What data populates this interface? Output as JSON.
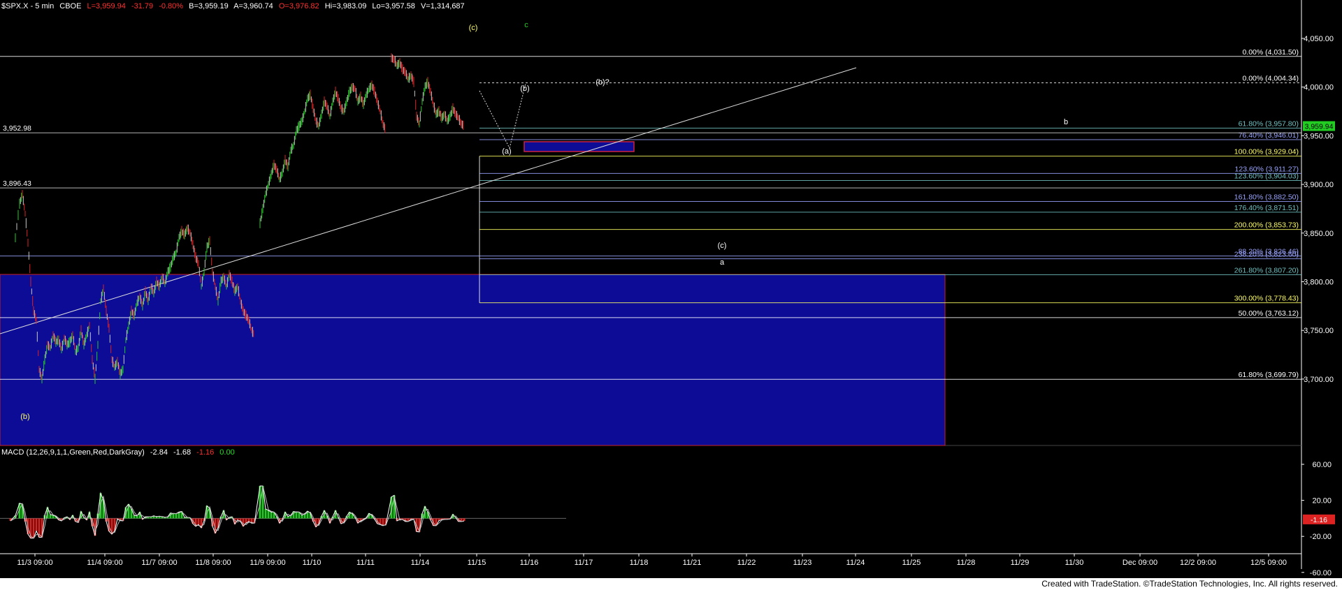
{
  "header": {
    "symbol": "$SPX.X - 5 min",
    "exchange": "CBOE",
    "last": "L=3,959.94",
    "change": "-31.79",
    "pct": "-0.80%",
    "bid": "B=3,959.19",
    "ask": "A=3,960.74",
    "open": "O=3,976.82",
    "high": "Hi=3,983.09",
    "low": "Lo=3,957.58",
    "volume": "V=1,314,687"
  },
  "macd_header": {
    "label": "MACD (12,26,9,1,1,Green,Red,DarkGray)",
    "v1": "-2.84",
    "v2": "-1.68",
    "v3": "-1.16",
    "v4": "0.00"
  },
  "footer": "Created with TradeStation. ©TradeStation Technologies, Inc. All rights reserved.",
  "colors": {
    "background": "#000000",
    "price_axis_text": "#ffffff",
    "blue_box": "#0c0c96",
    "up_bar": "#22cc22",
    "down_bar": "#dd2222"
  },
  "chart_data": [
    {
      "type": "line",
      "subtype": "price-bars-5min",
      "title": "$SPX.X - 5 min",
      "x_ticks": [
        "11/3 09:00",
        "11/4 09:00",
        "11/7 09:00",
        "11/8 09:00",
        "11/9 09:00",
        "11/10",
        "11/11",
        "11/14",
        "11/15",
        "11/16",
        "11/17",
        "11/18",
        "11/21",
        "11/22",
        "11/23",
        "11/24",
        "11/25",
        "11/28",
        "11/29",
        "11/30",
        "Dec 09:00",
        "12/2 09:00",
        "12/5 09:00"
      ],
      "y_ticks": [
        "4,050.00",
        "4,000.00",
        "3,950.00",
        "3,900.00",
        "3,850.00",
        "3,800.00",
        "3,750.00",
        "3,700.00"
      ],
      "ylim": [
        3645,
        4090
      ],
      "last_price_tag": "3,959.94",
      "price_path": [
        [
          0,
          3840
        ],
        [
          8,
          3836
        ],
        [
          15,
          3832
        ],
        [
          22,
          3845
        ],
        [
          28,
          3880
        ],
        [
          32,
          3890
        ],
        [
          36,
          3870
        ],
        [
          40,
          3840
        ],
        [
          44,
          3800
        ],
        [
          48,
          3770
        ],
        [
          52,
          3760
        ],
        [
          56,
          3710
        ],
        [
          60,
          3700
        ],
        [
          64,
          3720
        ],
        [
          68,
          3735
        ],
        [
          72,
          3732
        ],
        [
          76,
          3745
        ],
        [
          80,
          3738
        ],
        [
          84,
          3740
        ],
        [
          88,
          3730
        ],
        [
          92,
          3742
        ],
        [
          96,
          3735
        ],
        [
          100,
          3738
        ],
        [
          104,
          3745
        ],
        [
          108,
          3728
        ],
        [
          112,
          3732
        ],
        [
          116,
          3750
        ],
        [
          120,
          3735
        ],
        [
          124,
          3745
        ],
        [
          128,
          3755
        ],
        [
          132,
          3720
        ],
        [
          136,
          3700
        ],
        [
          140,
          3735
        ],
        [
          144,
          3780
        ],
        [
          148,
          3793
        ],
        [
          152,
          3770
        ],
        [
          156,
          3752
        ],
        [
          160,
          3720
        ],
        [
          164,
          3712
        ],
        [
          168,
          3718
        ],
        [
          172,
          3705
        ],
        [
          176,
          3710
        ],
        [
          180,
          3740
        ],
        [
          184,
          3755
        ],
        [
          188,
          3770
        ],
        [
          192,
          3765
        ],
        [
          196,
          3778
        ],
        [
          200,
          3785
        ],
        [
          204,
          3775
        ],
        [
          208,
          3790
        ],
        [
          212,
          3780
        ],
        [
          216,
          3795
        ],
        [
          220,
          3788
        ],
        [
          224,
          3800
        ],
        [
          228,
          3795
        ],
        [
          232,
          3805
        ],
        [
          236,
          3798
        ],
        [
          240,
          3810
        ],
        [
          244,
          3815
        ],
        [
          248,
          3825
        ],
        [
          252,
          3830
        ],
        [
          256,
          3845
        ],
        [
          260,
          3852
        ],
        [
          264,
          3848
        ],
        [
          268,
          3855
        ],
        [
          272,
          3850
        ],
        [
          276,
          3838
        ],
        [
          280,
          3825
        ],
        [
          284,
          3818
        ],
        [
          288,
          3795
        ],
        [
          292,
          3810
        ],
        [
          296,
          3835
        ],
        [
          300,
          3842
        ],
        [
          304,
          3810
        ],
        [
          308,
          3795
        ],
        [
          312,
          3780
        ],
        [
          316,
          3800
        ],
        [
          320,
          3805
        ],
        [
          324,
          3795
        ],
        [
          328,
          3808
        ],
        [
          332,
          3800
        ],
        [
          336,
          3790
        ],
        [
          340,
          3795
        ],
        [
          344,
          3780
        ],
        [
          348,
          3770
        ],
        [
          352,
          3765
        ],
        [
          356,
          3760
        ],
        [
          360,
          3750
        ],
        [
          364,
          3745
        ],
        [
          372,
          3860
        ],
        [
          376,
          3875
        ],
        [
          380,
          3890
        ],
        [
          384,
          3900
        ],
        [
          388,
          3910
        ],
        [
          392,
          3920
        ],
        [
          396,
          3915
        ],
        [
          400,
          3905
        ],
        [
          404,
          3912
        ],
        [
          408,
          3925
        ],
        [
          412,
          3918
        ],
        [
          416,
          3935
        ],
        [
          420,
          3940
        ],
        [
          424,
          3955
        ],
        [
          428,
          3960
        ],
        [
          432,
          3965
        ],
        [
          436,
          3975
        ],
        [
          440,
          3988
        ],
        [
          444,
          3992
        ],
        [
          448,
          3978
        ],
        [
          452,
          3965
        ],
        [
          456,
          3960
        ],
        [
          460,
          3972
        ],
        [
          464,
          3985
        ],
        [
          468,
          3980
        ],
        [
          472,
          3970
        ],
        [
          476,
          3985
        ],
        [
          480,
          3995
        ],
        [
          484,
          3988
        ],
        [
          488,
          3978
        ],
        [
          492,
          3975
        ],
        [
          496,
          3985
        ],
        [
          500,
          3995
        ],
        [
          504,
          4000
        ],
        [
          508,
          3998
        ],
        [
          512,
          3985
        ],
        [
          516,
          3990
        ],
        [
          520,
          3982
        ],
        [
          524,
          3992
        ],
        [
          528,
          3998
        ],
        [
          532,
          4002
        ],
        [
          536,
          3995
        ],
        [
          540,
          3985
        ],
        [
          544,
          3975
        ],
        [
          548,
          3962
        ],
        [
          552,
          3955
        ],
        [
          560,
          4030
        ],
        [
          564,
          4028
        ],
        [
          568,
          4022
        ],
        [
          572,
          4025
        ],
        [
          576,
          4018
        ],
        [
          580,
          4015
        ],
        [
          584,
          4008
        ],
        [
          588,
          4012
        ],
        [
          592,
          4005
        ],
        [
          596,
          3970
        ],
        [
          600,
          3962
        ],
        [
          604,
          3985
        ],
        [
          608,
          4000
        ],
        [
          612,
          4005
        ],
        [
          616,
          3995
        ],
        [
          620,
          3982
        ],
        [
          624,
          3972
        ],
        [
          628,
          3975
        ],
        [
          632,
          3968
        ],
        [
          636,
          3972
        ],
        [
          640,
          3965
        ],
        [
          644,
          3970
        ],
        [
          648,
          3978
        ],
        [
          652,
          3972
        ],
        [
          656,
          3968
        ],
        [
          660,
          3962
        ],
        [
          664,
          3959.94
        ]
      ]
    },
    {
      "type": "line",
      "title": "MACD (12,26,9,1,1,Green,Red,DarkGray)",
      "y_ticks": [
        "60.00",
        "20.00",
        "-20.00",
        "-60.00"
      ],
      "ylim": [
        -80,
        80
      ],
      "readouts": [
        "-2.84",
        "-1.68",
        "-1.16",
        "0.00"
      ],
      "tag": "-1.16",
      "series": [
        {
          "values_source": "5-minute bars aligned with price pane"
        }
      ]
    }
  ],
  "levels": {
    "right_labels": [
      {
        "label": "0.00% (4,031.50)",
        "value": 4031.5,
        "color": "#ffffff"
      },
      {
        "label": "0.00% (4,004.34)",
        "value": 4004.34,
        "color": "#ffffff"
      },
      {
        "label": "61.80% (3,957.80)",
        "value": 3957.8,
        "color": "#70c0c0"
      },
      {
        "label": "76.40% (3,946.01)",
        "value": 3946.01,
        "color": "#9aa4ff"
      },
      {
        "label": "100.00% (3,929.04)",
        "value": 3929.04,
        "color": "#ffff66"
      },
      {
        "label": "123.60% (3,911.27)",
        "value": 3911.27,
        "color": "#9aa4ff"
      },
      {
        "label": "123.60% (3,904.03)",
        "value": 3904.03,
        "color": "#70c0c0"
      },
      {
        "label": "161.80% (3,882.50)",
        "value": 3882.5,
        "color": "#9aa4ff"
      },
      {
        "label": "176.40% (3,871.51)",
        "value": 3871.51,
        "color": "#70c0c0"
      },
      {
        "label": "200.00% (3,853.73)",
        "value": 3853.73,
        "color": "#ffff66"
      },
      {
        "label": "88.20% (3,826.46)",
        "value": 3826.46,
        "color": "#9aa4ff"
      },
      {
        "label": "238.20% (3,823.60)",
        "value": 3823.6,
        "color": "#9aa4ff"
      },
      {
        "label": "261.80% (3,807.20)",
        "value": 3807.2,
        "color": "#70c0c0"
      },
      {
        "label": "300.00% (3,778.43)",
        "value": 3778.43,
        "color": "#ffff66"
      },
      {
        "label": "50.00% (3,763.12)",
        "value": 3763.12,
        "color": "#ffffff"
      },
      {
        "label": "61.80% (3,699.79)",
        "value": 3699.79,
        "color": "#ffffff"
      }
    ],
    "left_labels": [
      {
        "label": "3,952.98",
        "value": 3952.98
      },
      {
        "label": "3,896.43",
        "value": 3896.43
      }
    ],
    "wave_labels": [
      {
        "label": "(c)",
        "color": "#ffff66"
      },
      {
        "label": "c",
        "color": "#22cc22"
      },
      {
        "label": "(b)",
        "color": "#ffffff"
      },
      {
        "label": "(b)?",
        "color": "#ffffff"
      },
      {
        "label": "(a)",
        "color": "#ffffff"
      },
      {
        "label": "b",
        "color": "#ffffff"
      },
      {
        "label": "(c)",
        "color": "#ffffff"
      },
      {
        "label": "a",
        "color": "#ffffff"
      },
      {
        "label": "(b)",
        "color": "#ffff66"
      }
    ]
  }
}
